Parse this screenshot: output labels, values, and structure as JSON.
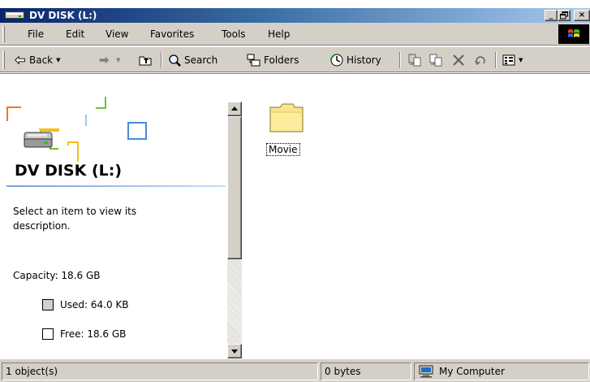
{
  "window": {
    "title": "DV DISK (L:)",
    "buttons": {
      "minimize": "_",
      "restore": "□",
      "close": "×"
    }
  },
  "menubar": {
    "items": [
      "File",
      "Edit",
      "View",
      "Favorites",
      "Tools",
      "Help"
    ]
  },
  "toolbar": {
    "back_label": "Back",
    "search_label": "Search",
    "folders_label": "Folders",
    "history_label": "History",
    "icons": [
      "back-arrow-icon",
      "forward-arrow-icon",
      "up-folder-icon",
      "search-icon",
      "folders-icon",
      "history-icon",
      "move-to-icon",
      "copy-to-icon",
      "delete-icon",
      "undo-icon",
      "views-icon"
    ]
  },
  "left_pane": {
    "drive_title": "DV DISK (L:)",
    "description": "Select an item to view its description.",
    "capacity": "Capacity: 18.6 GB",
    "used": "Used: 64.0 KB",
    "free": "Free: 18.6 GB",
    "used_color": "#d4d0c8",
    "free_color": "#ffffff"
  },
  "files": [
    {
      "name": "Movie",
      "type": "folder"
    }
  ],
  "statusbar": {
    "objects": "1 object(s)",
    "size": "0 bytes",
    "zone": "My Computer"
  },
  "colors": {
    "titlebar_start": "#0a246a",
    "titlebar_end": "#a6caf0",
    "chrome": "#d4d0c8"
  }
}
